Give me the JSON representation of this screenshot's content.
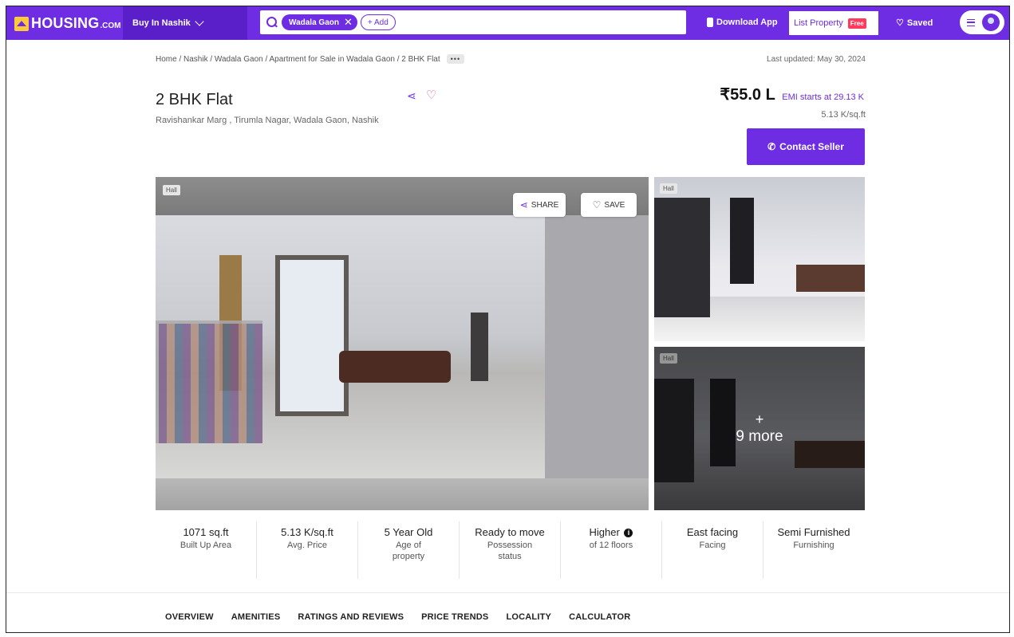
{
  "header": {
    "logo_text": "HOUSING",
    "logo_sub": ".COM",
    "city_button": "Buy In Nashik",
    "search_chip": "Wadala Gaon",
    "add_chip": "+ Add",
    "download_app": "Download App",
    "list_property": "List Property",
    "free_badge": "Free",
    "saved": "Saved"
  },
  "listing": {
    "breadcrumb": "Home / Nashik / Wadala Gaon / Apartment for Sale in Wadala Gaon / 2 BHK Flat",
    "breadcrumb_more": "•••",
    "last_updated": "Last updated: May 30, 2024",
    "title": "2 BHK Flat",
    "address": "Ravishankar Marg , Tirumla Nagar, Wadala Gaon, Nashik",
    "price": "₹55.0 L",
    "emi": "EMI starts at  29.13 K",
    "price_per_sqft": "5.13 K/sq.ft",
    "contact_button": "Contact Seller"
  },
  "gallery": {
    "main_tag": "Hall",
    "share_label": "SHARE",
    "save_label": "SAVE",
    "thumb1_tag": "Hall",
    "thumb2_tag": "Hall",
    "more_plus": "+",
    "more_text": "9 more"
  },
  "stats": [
    {
      "value": "1071 sq.ft",
      "label": "Built Up Area"
    },
    {
      "value": "5.13 K/sq.ft",
      "label": "Avg. Price"
    },
    {
      "value": "5 Year Old",
      "label": "Age of property"
    },
    {
      "value": "Ready to move",
      "label": "Possession status"
    },
    {
      "value": "Higher",
      "label": "of 12 floors"
    },
    {
      "value": "East facing",
      "label": "Facing"
    },
    {
      "value": "Semi Furnished",
      "label": "Furnishing"
    }
  ],
  "tabs": [
    "OVERVIEW",
    "AMENITIES",
    "RATINGS AND REVIEWS",
    "PRICE TRENDS",
    "LOCALITY",
    "CALCULATOR"
  ],
  "colors": {
    "brand": "#6e2de3",
    "accent": "#ffc93c",
    "free_badge": "#ff3b5c"
  }
}
